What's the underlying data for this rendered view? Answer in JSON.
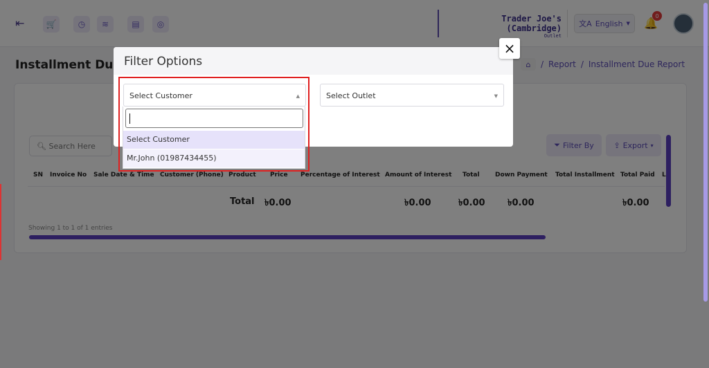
{
  "header": {
    "outlet_name": "Trader Joe's (Cambridge)",
    "outlet_label": "Outlet",
    "language": "English",
    "notification_count": "0",
    "tools": [
      "cart-icon",
      "clock-icon",
      "layers-icon",
      "document-icon",
      "globe-icon"
    ]
  },
  "page": {
    "title": "Installment Due",
    "breadcrumb": [
      "Report",
      "Installment Due Report"
    ]
  },
  "toolbar": {
    "search_placeholder": "Search Here",
    "filter_label": "Filter By",
    "export_label": "Export"
  },
  "table": {
    "columns": [
      "SN",
      "Invoice No",
      "Sale Date & Time",
      "Customer (Phone)",
      "Product",
      "Price",
      "Percentage of Interest",
      "Amount of Interest",
      "Total",
      "Down Payment",
      "Total Installment",
      "Total Paid",
      "L"
    ],
    "total_label": "Total",
    "totals": {
      "price": "৳0.00",
      "amount_of_interest": "৳0.00",
      "total": "৳0.00",
      "down_payment": "৳0.00",
      "total_paid": "৳0.00"
    },
    "showing": "Showing 1 to 1 of 1 entries"
  },
  "modal": {
    "title": "Filter Options",
    "close_label": "×",
    "customer_select": {
      "value": "Select Customer",
      "search_value": "",
      "options": [
        "Select Customer",
        "Mr.John (01987434455)"
      ]
    },
    "outlet_select": {
      "value": "Select Outlet"
    }
  },
  "colors": {
    "accent": "#5b3fc0",
    "highlight": "#e02020"
  }
}
